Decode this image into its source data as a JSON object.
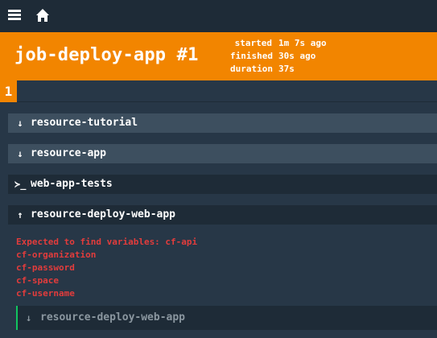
{
  "header": {
    "title": "job-deploy-app #1",
    "stats": [
      {
        "key": "started",
        "value": "1m 7s ago"
      },
      {
        "key": "finished",
        "value": "30s ago"
      },
      {
        "key": "duration",
        "value": "37s"
      }
    ],
    "build_tab": "1"
  },
  "steps": [
    {
      "icon": "↓",
      "icon_name": "arrow-down-icon",
      "label": "resource-tutorial"
    },
    {
      "icon": "↓",
      "icon_name": "arrow-down-icon",
      "label": "resource-app"
    },
    {
      "icon": "≻_",
      "icon_name": "terminal-icon",
      "label": "web-app-tests"
    },
    {
      "icon": "↑",
      "icon_name": "arrow-up-icon",
      "label": "resource-deploy-web-app"
    }
  ],
  "errors": [
    "Expected to find variables: cf-api",
    "cf-organization",
    "cf-password",
    "cf-space",
    "cf-username"
  ],
  "nested_step": {
    "icon": "↓",
    "icon_name": "arrow-down-icon",
    "label": "resource-deploy-web-app"
  },
  "colors": {
    "accent": "#f28500",
    "error": "#e23c3c",
    "success": "#11c560",
    "background": "#273747"
  }
}
